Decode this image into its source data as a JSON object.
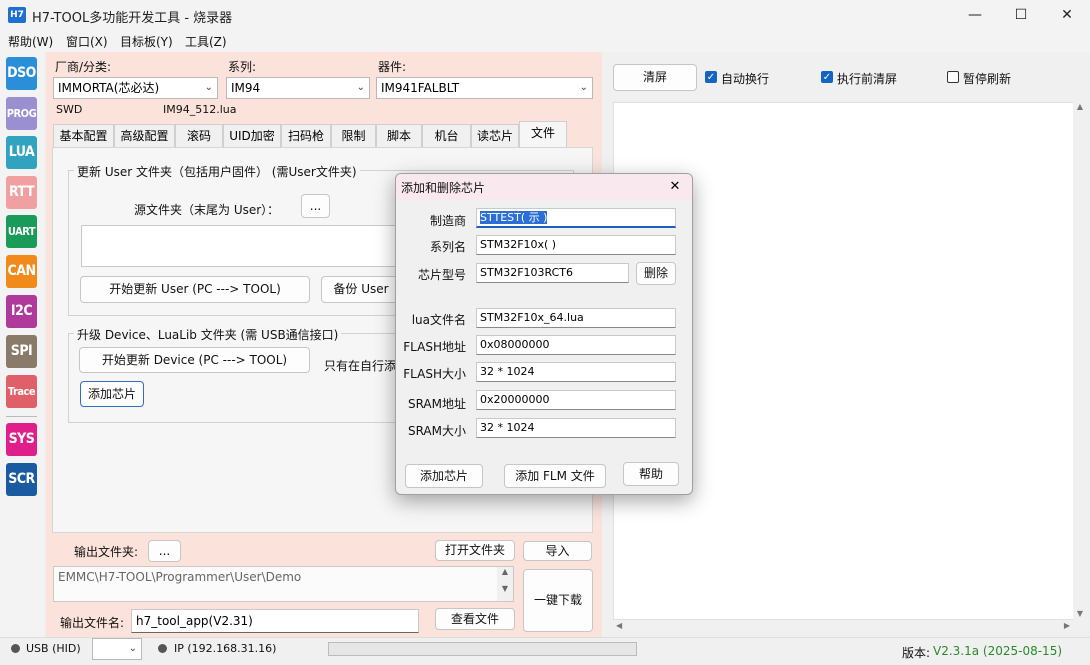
{
  "window": {
    "app_icon_text": "H7",
    "title": "H7-TOOL多功能开发工具 - 烧录器",
    "minimize": "—",
    "maximize": "☐",
    "close": "✕"
  },
  "menu": [
    "帮助(W)",
    "窗口(X)",
    "目标板(Y)",
    "工具(Z)"
  ],
  "sidebar": [
    {
      "label": "DSO",
      "color": "#2a8fd8"
    },
    {
      "label": "PROG",
      "color": "#9a8fd0"
    },
    {
      "label": "LUA",
      "color": "#2fa3c0"
    },
    {
      "label": "RTT",
      "color": "#f0a0a0"
    },
    {
      "label": "UART",
      "color": "#1a9b5a"
    },
    {
      "label": "CAN",
      "color": "#f08a1a"
    },
    {
      "label": "I2C",
      "color": "#b03a9a"
    },
    {
      "label": "SPI",
      "color": "#8a7a6a"
    },
    {
      "label": "Trace",
      "color": "#e0606a"
    },
    {
      "label": "SYS",
      "color": "#e0208a"
    },
    {
      "label": "SCR",
      "color": "#1a5aa0"
    }
  ],
  "selectors": {
    "vendor_label": "厂商/分类:",
    "vendor_value": "IMMORTA(芯必达)",
    "series_label": "系列:",
    "series_value": "IM94",
    "device_label": "器件:",
    "device_value": "IM941FALBLT",
    "interface": "SWD",
    "lua_file": "IM94_512.lua"
  },
  "tabs": [
    "基本配置",
    "高级配置",
    "滚码",
    "UID加密",
    "扫码枪",
    "限制",
    "脚本",
    "机台",
    "读芯片",
    "文件"
  ],
  "file_tab": {
    "group1_title": "更新 User 文件夹（包括用户固件）  (需User文件夹)",
    "source_folder_label": "源文件夹（末尾为 User）：",
    "browse_button": "...",
    "start_update_user": "开始更新 User   (PC ---> TOOL)",
    "backup_user": "备份 User",
    "group2_title": "升级 Device、LuaLib 文件夹  (需 USB通信接口)",
    "start_update_device": "开始更新 Device  (PC ---> TOOL)",
    "note_text": "只有在自行添",
    "add_chip_button": "添加芯片"
  },
  "bottom": {
    "output_folder_label": "输出文件夹:",
    "output_folder_btn": "...",
    "open_folder_btn": "打开文件夹",
    "import_btn": "导入",
    "path_text": "EMMC\\H7-TOOL\\Programmer\\User\\Demo",
    "one_key_download": "一键下载",
    "output_filename_label": "输出文件名:",
    "output_filename_value": "h7_tool_app(V2.31)",
    "view_file_btn": "查看文件"
  },
  "right": {
    "clear_btn": "清屏",
    "auto_wrap": {
      "label": "自动换行",
      "checked": true
    },
    "clear_before_exec": {
      "label": "执行前清屏",
      "checked": true
    },
    "pause_refresh": {
      "label": "暂停刷新",
      "checked": false
    }
  },
  "status": {
    "usb": "USB (HID)",
    "ip": "IP (192.168.31.16)",
    "version_label": "版本:",
    "version_value": "V2.3.1a (2025-08-15)",
    "version_color": "#2a8a2a"
  },
  "dialog": {
    "title": "添加和删除芯片",
    "close": "✕",
    "fields": {
      "manufacturer_label": "制造商",
      "manufacturer_value": "STTEST(  示  )",
      "series_label": "系列名",
      "series_value": "STM32F10x(     )",
      "chip_label": "芯片型号",
      "chip_value": "STM32F103RCT6",
      "delete_btn": "删除",
      "lua_label": "lua文件名",
      "lua_value": "STM32F10x_64.lua",
      "flash_addr_label": "FLASH地址",
      "flash_addr_value": "0x08000000",
      "flash_size_label": "FLASH大小",
      "flash_size_value": "32 * 1024",
      "sram_addr_label": "SRAM地址",
      "sram_addr_value": "0x20000000",
      "sram_size_label": "SRAM大小",
      "sram_size_value": "32 * 1024"
    },
    "add_chip_btn": "添加芯片",
    "add_flm_btn": "添加 FLM 文件",
    "help_btn": "帮助"
  }
}
